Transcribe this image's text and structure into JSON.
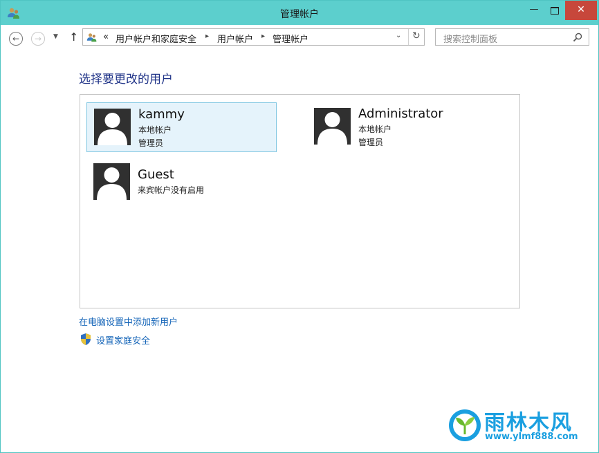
{
  "window": {
    "title": "管理帐户"
  },
  "controls": {
    "minimize": "—",
    "close": "✕"
  },
  "nav": {
    "back_glyph": "←",
    "forward_glyph": "→",
    "recent_glyph": "▼",
    "up_glyph": "↑",
    "overflow": "«",
    "breadcrumbs": [
      "用户帐户和家庭安全",
      "用户帐户",
      "管理帐户"
    ],
    "separator": "▸",
    "dropdown_glyph": "⌄",
    "refresh_glyph": "↻"
  },
  "search": {
    "placeholder": "搜索控制面板"
  },
  "main": {
    "heading": "选择要更改的用户",
    "users": [
      {
        "name": "kammy",
        "type": "本地帐户",
        "role": "管理员",
        "selected": true
      },
      {
        "name": "Administrator",
        "type": "本地帐户",
        "role": "管理员",
        "selected": false
      },
      {
        "name": "Guest",
        "status": "来宾帐户没有启用",
        "selected": false
      }
    ]
  },
  "links": {
    "add_user": "在电脑设置中添加新用户",
    "family_safety": "设置家庭安全"
  },
  "watermark": {
    "brand": "雨林木风",
    "url": "www.ylmf888.com"
  },
  "colors": {
    "titlebar": "#5ccfcd",
    "close_button": "#c7473b",
    "heading": "#1e3287",
    "link": "#1565b8",
    "selected_tile": "#e5f3fb",
    "watermark": "#1a9fe0"
  },
  "icons": {
    "app": "user-accounts-icon",
    "address": "user-accounts-icon",
    "search": "search-icon",
    "avatar": "user-silhouette-icon",
    "family": "shield-icon"
  }
}
